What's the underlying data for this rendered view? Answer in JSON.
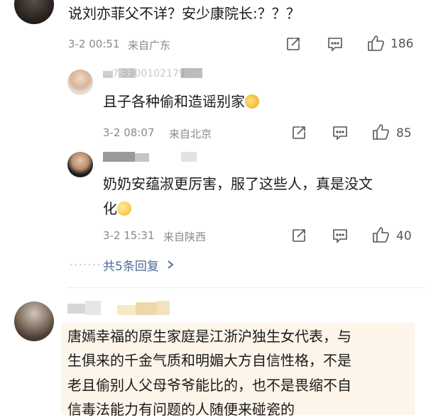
{
  "comment1": {
    "text": "说刘亦菲父不详？安少康院长:？？？",
    "date": "3-2 00:51",
    "location": "来自广东",
    "likes": "186"
  },
  "reply1": {
    "username": "...7 3300102179",
    "text": "且子各种偷和造谣别家",
    "emoji": "cat-face-emoji",
    "date": "3-2 08:07",
    "location": "来自北京",
    "likes": "85"
  },
  "reply2": {
    "text_line1": "奶奶安蕴淑更厉害，服了这些人，真是没文",
    "text_line2": "化",
    "emoji": "smile-emoji",
    "date": "3-2 15:31",
    "location": "来自陕西",
    "likes": "40"
  },
  "replies_footer": {
    "label": "共5条回复",
    "chevron": "chevron-right-icon"
  },
  "comment2": {
    "line1": "唐嫣幸福的原生家庭是江浙沪独生女代表，与",
    "line2": "生俱来的千金气质和明媚大方自信性格，不是",
    "line3": "老且偷别人父母爷爷能比的，也不是畏缩不自",
    "line4": "信毒法能力有问题的人随便来碰瓷的"
  },
  "colors": {
    "highlight_bg": "#fdf4ea",
    "meta_gray": "#8a8a8a",
    "link_blue": "#4a6b97"
  }
}
